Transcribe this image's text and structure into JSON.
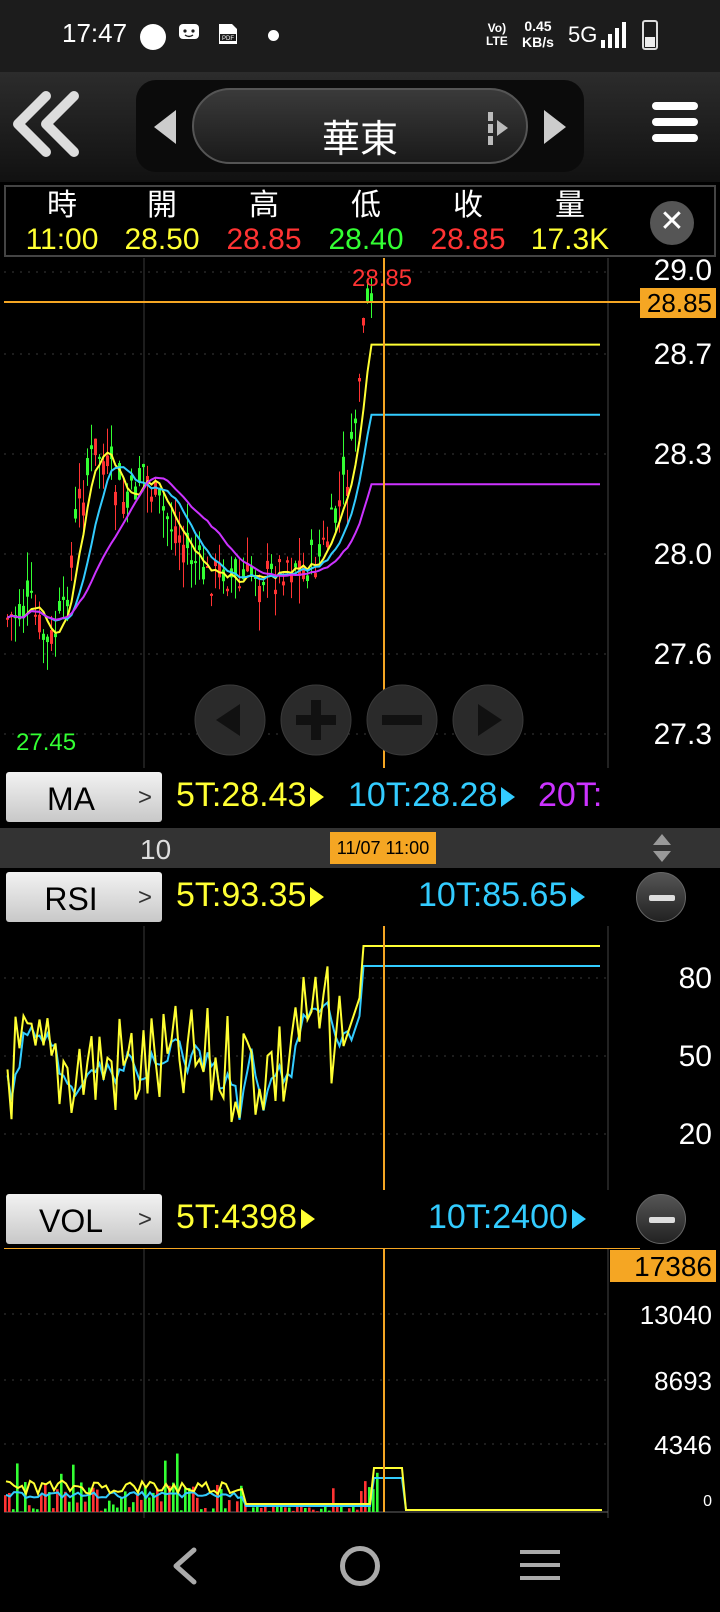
{
  "status_bar": {
    "time": "17:47",
    "network_speed_value": "0.45",
    "network_speed_unit": "KB/s",
    "volte_top": "Vo)",
    "volte_bottom": "LTE",
    "network_type": "5G",
    "icons": [
      "notification-dot-icon",
      "chat-icon",
      "pdf-icon",
      "dot-icon",
      "signal-icon",
      "battery-icon"
    ]
  },
  "header": {
    "stock_name": "華東",
    "icons": [
      "double-chevron-left-icon",
      "arrow-left-icon",
      "arrow-right-icon",
      "hamburger-menu-icon"
    ]
  },
  "ohlc": {
    "columns": [
      {
        "label": "時",
        "value": "11:00",
        "color": "#ffff33"
      },
      {
        "label": "開",
        "value": "28.50",
        "color": "#ffff33"
      },
      {
        "label": "高",
        "value": "28.85",
        "color": "#ff3333"
      },
      {
        "label": "低",
        "value": "28.40",
        "color": "#33ff33"
      },
      {
        "label": "收",
        "value": "28.85",
        "color": "#ff3333"
      },
      {
        "label": "量",
        "value": "17.3K",
        "color": "#ffff33"
      }
    ]
  },
  "price_chart": {
    "high_label": "28.85",
    "low_label": "27.45",
    "current_price_tag": "28.85",
    "y_ticks": [
      "29.0",
      "28.7",
      "28.3",
      "28.0",
      "27.6",
      "27.3"
    ]
  },
  "ma_bar": {
    "button_label": "MA",
    "chevron": ">",
    "ma5": "5T:28.43",
    "ma10": "10T:28.28",
    "ma20": "20T:",
    "colors": {
      "ma5": "#ffff33",
      "ma10": "#33ccff",
      "ma20": "#cc33ff"
    }
  },
  "time_bar": {
    "left_label": "10",
    "cursor_label": "11/07 11:00"
  },
  "rsi": {
    "button_label": "RSI",
    "chevron": ">",
    "rsi5": "5T:93.35",
    "rsi10": "10T:85.65",
    "y_ticks": [
      "80",
      "50",
      "20"
    ]
  },
  "vol": {
    "button_label": "VOL",
    "chevron": ">",
    "vol5": "5T:4398",
    "vol10": "10T:2400",
    "current_tag": "17386",
    "y_ticks": [
      "13040",
      "8693",
      "4346",
      "0"
    ]
  },
  "colors": {
    "up": "#ff3333",
    "down": "#33ff33",
    "cursor": "#f5a623",
    "grid": "#3a3a3a",
    "yellow": "#ffff33",
    "cyan": "#33ccff",
    "purple": "#cc33ff"
  }
}
